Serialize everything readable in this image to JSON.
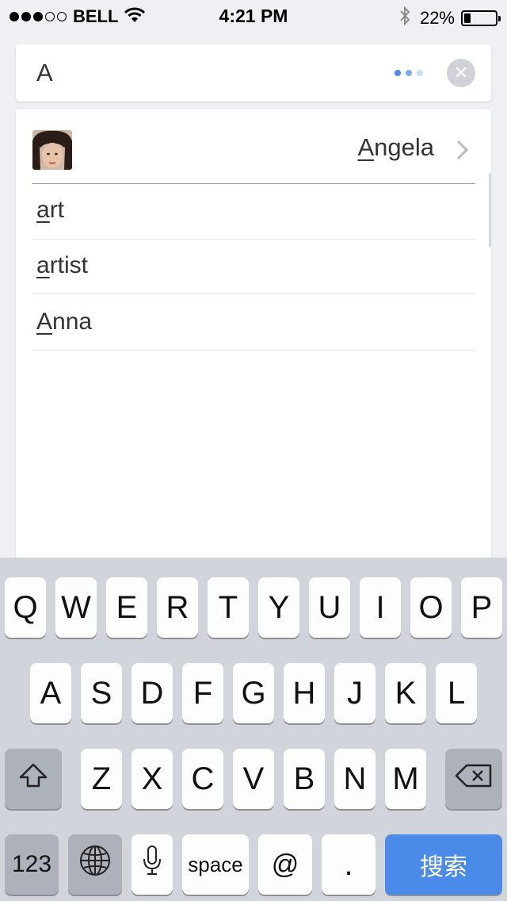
{
  "status_bar": {
    "carrier": "BELL",
    "time": "4:21 PM",
    "battery_percent": "22%",
    "battery_level": 0.22,
    "signal_bars": 3,
    "signal_total": 5
  },
  "search": {
    "query": "A",
    "loading_dot_colors": [
      "#4a8bea",
      "#7aaaf0",
      "#c9dcf8"
    ]
  },
  "results": {
    "contact": {
      "name": "Angela",
      "match": "A",
      "rest": "ngela"
    },
    "suggestions": [
      {
        "text": "art",
        "match": "a",
        "rest": "rt"
      },
      {
        "text": "artist",
        "match": "a",
        "rest": "rtist"
      },
      {
        "text": "Anna",
        "match": "A",
        "rest": "nna"
      }
    ]
  },
  "keyboard": {
    "row1": [
      "Q",
      "W",
      "E",
      "R",
      "T",
      "Y",
      "U",
      "I",
      "O",
      "P"
    ],
    "row2": [
      "A",
      "S",
      "D",
      "F",
      "G",
      "H",
      "J",
      "K",
      "L"
    ],
    "row3": [
      "Z",
      "X",
      "C",
      "V",
      "B",
      "N",
      "M"
    ],
    "numbers_label": "123",
    "space_label": "space",
    "at_label": "@",
    "period_label": ".",
    "search_label": "搜索"
  },
  "colors": {
    "accent": "#4a8bea",
    "background": "#eff0f4",
    "keyboard_bg": "#d1d4da"
  }
}
